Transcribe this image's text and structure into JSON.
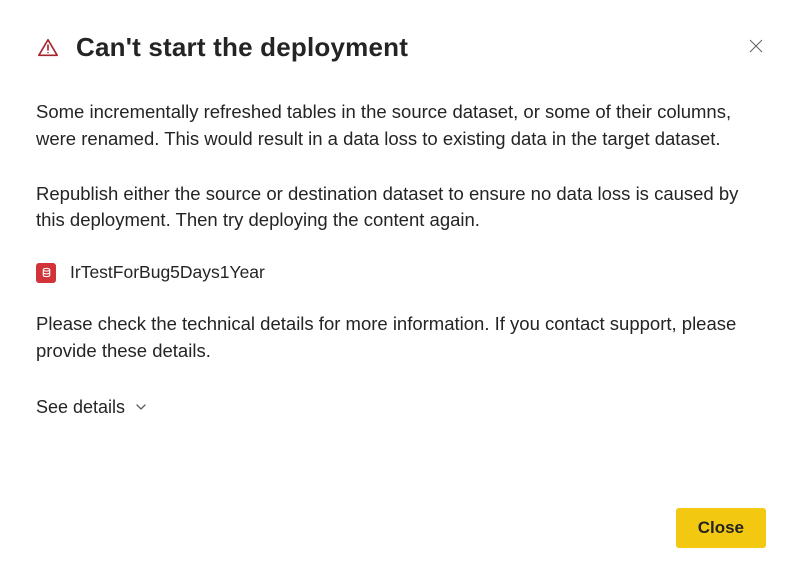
{
  "dialog": {
    "title": "Can't start the deployment",
    "paragraph1": "Some incrementally refreshed tables in the source dataset, or some of their columns, were renamed. This would result in a data loss to existing data in the target dataset.",
    "paragraph2": "Republish either the source or destination dataset to ensure no data loss is caused by this deployment. Then try deploying the content again.",
    "dataset_name": "IrTestForBug5Days1Year",
    "paragraph3": "Please check the technical details for more information. If you contact support, please provide these details.",
    "see_details_label": "See details",
    "close_button_label": "Close"
  },
  "colors": {
    "warning": "#a4262c",
    "dataset_icon": "#d13438",
    "primary_button": "#f2c811"
  }
}
